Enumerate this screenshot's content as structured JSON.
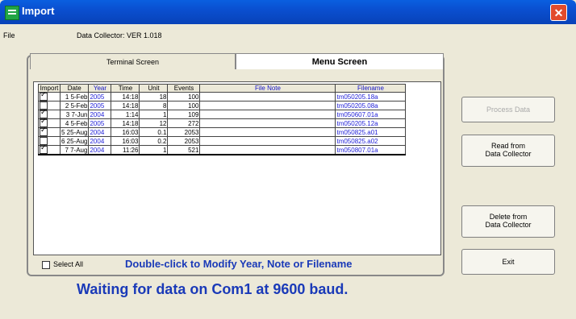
{
  "window": {
    "title": "Import",
    "close_glyph": "✕"
  },
  "menu": {
    "file": "File",
    "collector_label": "Data Collector: VER 1.018"
  },
  "tabs": {
    "terminal": "Terminal Screen",
    "menu": "Menu Screen"
  },
  "table": {
    "headers": [
      "Import",
      "Date",
      "Year",
      "Time",
      "Unit",
      "Events",
      "File Note",
      "Filename"
    ],
    "rows": [
      {
        "checked": true,
        "num": "1",
        "date": "5-Feb",
        "year": "2005",
        "time": "14:18",
        "unit": "18",
        "events": "100",
        "note": "",
        "filename": "tm050205.18a"
      },
      {
        "checked": false,
        "num": "2",
        "date": "5-Feb",
        "year": "2005",
        "time": "14:18",
        "unit": "8",
        "events": "100",
        "note": "",
        "filename": "tm050205.08a"
      },
      {
        "checked": true,
        "num": "3",
        "date": "7-Jun",
        "year": "2004",
        "time": "1:14",
        "unit": "1",
        "events": "109",
        "note": "",
        "filename": "tm050607.01a"
      },
      {
        "checked": true,
        "num": "4",
        "date": "5-Feb",
        "year": "2005",
        "time": "14:18",
        "unit": "12",
        "events": "272",
        "note": "",
        "filename": "tm050205.12a"
      },
      {
        "checked": true,
        "num": "5",
        "date": "25-Aug",
        "year": "2004",
        "time": "16:03",
        "unit": "0.1",
        "events": "2053",
        "note": "",
        "filename": "tm050825.a01"
      },
      {
        "checked": false,
        "num": "6",
        "date": "25-Aug",
        "year": "2004",
        "time": "16:03",
        "unit": "0.2",
        "events": "2053",
        "note": "",
        "filename": "tm050825.a02"
      },
      {
        "checked": true,
        "num": "7",
        "date": "7-Aug",
        "year": "2004",
        "time": "11:26",
        "unit": "1",
        "events": "521",
        "note": "",
        "filename": "tm050807.01a"
      }
    ]
  },
  "select_all": {
    "label": "Select All",
    "checked": false
  },
  "hint": "Double-click to Modify Year, Note or Filename",
  "status": "Waiting for data on Com1 at 9600 baud.",
  "buttons": {
    "process": "Process Data",
    "read": [
      "Read from",
      "Data Collector"
    ],
    "delete": [
      "Delete from",
      "Data Collector"
    ],
    "exit": "Exit"
  },
  "colors": {
    "titlebar": "#0A4FD0",
    "link_blue": "#2222D8",
    "status_blue": "#1A3AB8",
    "face": "#ECE9D8"
  }
}
